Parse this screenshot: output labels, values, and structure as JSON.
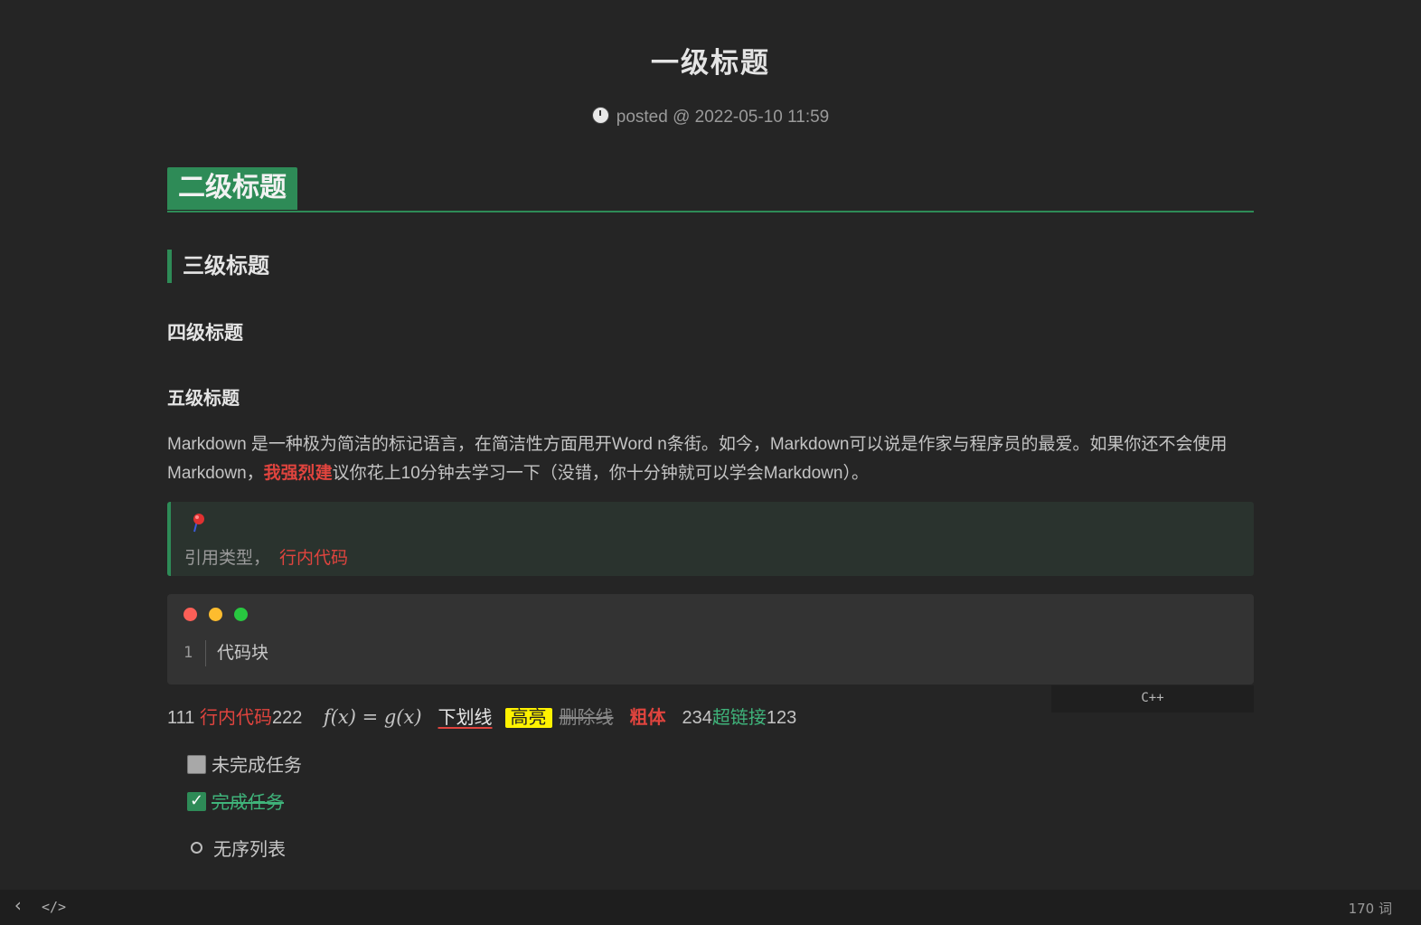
{
  "header": {
    "title": "一级标题",
    "meta_text": "posted @ 2022-05-10 11:59"
  },
  "headings": {
    "h2": "二级标题",
    "h3": "三级标题",
    "h4": "四级标题",
    "h5": "五级标题"
  },
  "paragraph": {
    "part1": "Markdown 是一种极为简洁的标记语言，在简洁性方面甩开Word n条街。如今，Markdown可以说是作家与程序员的最爱。如果你还不会使用Markdown，",
    "strong": "我强烈建",
    "part2": "议你花上10分钟去学习一下（没错，你十分钟就可以学会Markdown）。"
  },
  "blockquote": {
    "text": "引用类型，",
    "inline_code": "行内代码",
    "icon": "pushpin-icon"
  },
  "codeblock": {
    "line_number": "1",
    "code": "代码块",
    "language": "C++"
  },
  "inline_row": {
    "prefix": "111",
    "inline_code": "行内代码",
    "after_code": "222",
    "math": "f(x) = g(x)",
    "underline": "下划线",
    "highlight": "高亮",
    "strikethrough": "删除线",
    "bold": "粗体",
    "before_link": "234",
    "link": "超链接",
    "after_link": "123"
  },
  "tasks": [
    {
      "label": "未完成任务",
      "done": false
    },
    {
      "label": "完成任务",
      "done": true
    }
  ],
  "unordered_list": [
    "无序列表"
  ],
  "statusbar": {
    "back_icon": "chevron-left-icon",
    "source_icon": "code-icon",
    "back_glyph": "‹",
    "source_glyph": "</>",
    "word_count": "170 词"
  },
  "colors": {
    "accent": "#2e8b57",
    "red": "#e0443e",
    "link": "#3fb37a",
    "highlight": "#fff200"
  }
}
